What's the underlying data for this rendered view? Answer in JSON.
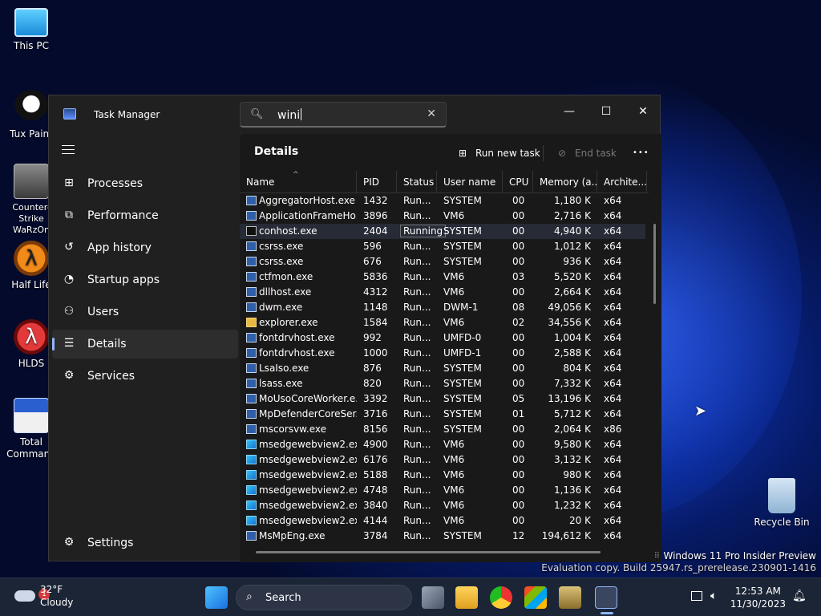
{
  "desktop": {
    "icons": [
      {
        "label": "This PC"
      },
      {
        "label": "Tux Paint"
      },
      {
        "label": "Counter-Strike WaRzOn"
      },
      {
        "label": "Half Life"
      },
      {
        "label": "HLDS"
      },
      {
        "label": "Total Command"
      },
      {
        "label": "Recycle Bin"
      }
    ]
  },
  "window": {
    "title": "Task Manager",
    "search_value": "wini",
    "minimize": "—",
    "maximize": "☐",
    "close": "✕"
  },
  "sidebar": {
    "items": [
      {
        "label": "Processes",
        "icon": "grid-icon"
      },
      {
        "label": "Performance",
        "icon": "performance-icon"
      },
      {
        "label": "App history",
        "icon": "history-icon"
      },
      {
        "label": "Startup apps",
        "icon": "startup-icon"
      },
      {
        "label": "Users",
        "icon": "users-icon"
      },
      {
        "label": "Details",
        "icon": "details-icon"
      },
      {
        "label": "Services",
        "icon": "services-icon"
      }
    ],
    "settings_label": "Settings"
  },
  "details": {
    "title": "Details",
    "run_new_task": "Run new task",
    "end_task": "End task",
    "more": "•••",
    "columns": [
      "Name",
      "PID",
      "Status",
      "User name",
      "CPU",
      "Memory (a...",
      "Archite..."
    ],
    "rows": [
      {
        "name": "AggregatorHost.exe",
        "pid": "1432",
        "status": "Run...",
        "user": "SYSTEM",
        "cpu": "00",
        "mem": "1,180 K",
        "arch": "x64",
        "icon": "app"
      },
      {
        "name": "ApplicationFrameHo...",
        "pid": "3896",
        "status": "Run...",
        "user": "VM6",
        "cpu": "00",
        "mem": "2,716 K",
        "arch": "x64",
        "icon": "app"
      },
      {
        "name": "conhost.exe",
        "pid": "2404",
        "status": "Running",
        "user": "SYSTEM",
        "cpu": "00",
        "mem": "4,940 K",
        "arch": "x64",
        "icon": "console"
      },
      {
        "name": "csrss.exe",
        "pid": "596",
        "status": "Run...",
        "user": "SYSTEM",
        "cpu": "00",
        "mem": "1,012 K",
        "arch": "x64",
        "icon": "app"
      },
      {
        "name": "csrss.exe",
        "pid": "676",
        "status": "Run...",
        "user": "SYSTEM",
        "cpu": "00",
        "mem": "936 K",
        "arch": "x64",
        "icon": "app"
      },
      {
        "name": "ctfmon.exe",
        "pid": "5836",
        "status": "Run...",
        "user": "VM6",
        "cpu": "03",
        "mem": "5,520 K",
        "arch": "x64",
        "icon": "app"
      },
      {
        "name": "dllhost.exe",
        "pid": "4312",
        "status": "Run...",
        "user": "VM6",
        "cpu": "00",
        "mem": "2,664 K",
        "arch": "x64",
        "icon": "app"
      },
      {
        "name": "dwm.exe",
        "pid": "1148",
        "status": "Run...",
        "user": "DWM-1",
        "cpu": "08",
        "mem": "49,056 K",
        "arch": "x64",
        "icon": "app"
      },
      {
        "name": "explorer.exe",
        "pid": "1584",
        "status": "Run...",
        "user": "VM6",
        "cpu": "02",
        "mem": "34,556 K",
        "arch": "x64",
        "icon": "folder"
      },
      {
        "name": "fontdrvhost.exe",
        "pid": "992",
        "status": "Run...",
        "user": "UMFD-0",
        "cpu": "00",
        "mem": "1,004 K",
        "arch": "x64",
        "icon": "app"
      },
      {
        "name": "fontdrvhost.exe",
        "pid": "1000",
        "status": "Run...",
        "user": "UMFD-1",
        "cpu": "00",
        "mem": "2,588 K",
        "arch": "x64",
        "icon": "app"
      },
      {
        "name": "LsaIso.exe",
        "pid": "876",
        "status": "Run...",
        "user": "SYSTEM",
        "cpu": "00",
        "mem": "804 K",
        "arch": "x64",
        "icon": "app"
      },
      {
        "name": "lsass.exe",
        "pid": "820",
        "status": "Run...",
        "user": "SYSTEM",
        "cpu": "00",
        "mem": "7,332 K",
        "arch": "x64",
        "icon": "app"
      },
      {
        "name": "MoUsoCoreWorker.e...",
        "pid": "3392",
        "status": "Run...",
        "user": "SYSTEM",
        "cpu": "05",
        "mem": "13,196 K",
        "arch": "x64",
        "icon": "app"
      },
      {
        "name": "MpDefenderCoreSer...",
        "pid": "3716",
        "status": "Run...",
        "user": "SYSTEM",
        "cpu": "01",
        "mem": "5,712 K",
        "arch": "x64",
        "icon": "app"
      },
      {
        "name": "mscorsvw.exe",
        "pid": "8156",
        "status": "Run...",
        "user": "SYSTEM",
        "cpu": "00",
        "mem": "2,064 K",
        "arch": "x86",
        "icon": "app"
      },
      {
        "name": "msedgewebview2.exe",
        "pid": "4900",
        "status": "Run...",
        "user": "VM6",
        "cpu": "00",
        "mem": "9,580 K",
        "arch": "x64",
        "icon": "edge"
      },
      {
        "name": "msedgewebview2.exe",
        "pid": "6176",
        "status": "Run...",
        "user": "VM6",
        "cpu": "00",
        "mem": "3,132 K",
        "arch": "x64",
        "icon": "edge"
      },
      {
        "name": "msedgewebview2.exe",
        "pid": "5188",
        "status": "Run...",
        "user": "VM6",
        "cpu": "00",
        "mem": "980 K",
        "arch": "x64",
        "icon": "edge"
      },
      {
        "name": "msedgewebview2.exe",
        "pid": "4748",
        "status": "Run...",
        "user": "VM6",
        "cpu": "00",
        "mem": "1,136 K",
        "arch": "x64",
        "icon": "edge"
      },
      {
        "name": "msedgewebview2.exe",
        "pid": "3840",
        "status": "Run...",
        "user": "VM6",
        "cpu": "00",
        "mem": "1,232 K",
        "arch": "x64",
        "icon": "edge"
      },
      {
        "name": "msedgewebview2.exe",
        "pid": "4144",
        "status": "Run...",
        "user": "VM6",
        "cpu": "00",
        "mem": "20 K",
        "arch": "x64",
        "icon": "edge"
      },
      {
        "name": "MsMpEng.exe",
        "pid": "3784",
        "status": "Run...",
        "user": "SYSTEM",
        "cpu": "12",
        "mem": "194,612 K",
        "arch": "x64",
        "icon": "app"
      }
    ]
  },
  "watermark": {
    "line1": "Windows 11 Pro Insider Preview",
    "line2": "Evaluation copy. Build 25947.rs_prerelease.230901-1416"
  },
  "taskbar": {
    "weather_temp": "32°F",
    "weather_desc": "Cloudy",
    "weather_badge": "1",
    "search_label": "Search",
    "time": "12:53 AM",
    "date": "11/30/2023"
  },
  "colors": {
    "accent": "#8fb6ff",
    "window_bg": "#202020",
    "taskbar_bg": "#1c2536"
  }
}
